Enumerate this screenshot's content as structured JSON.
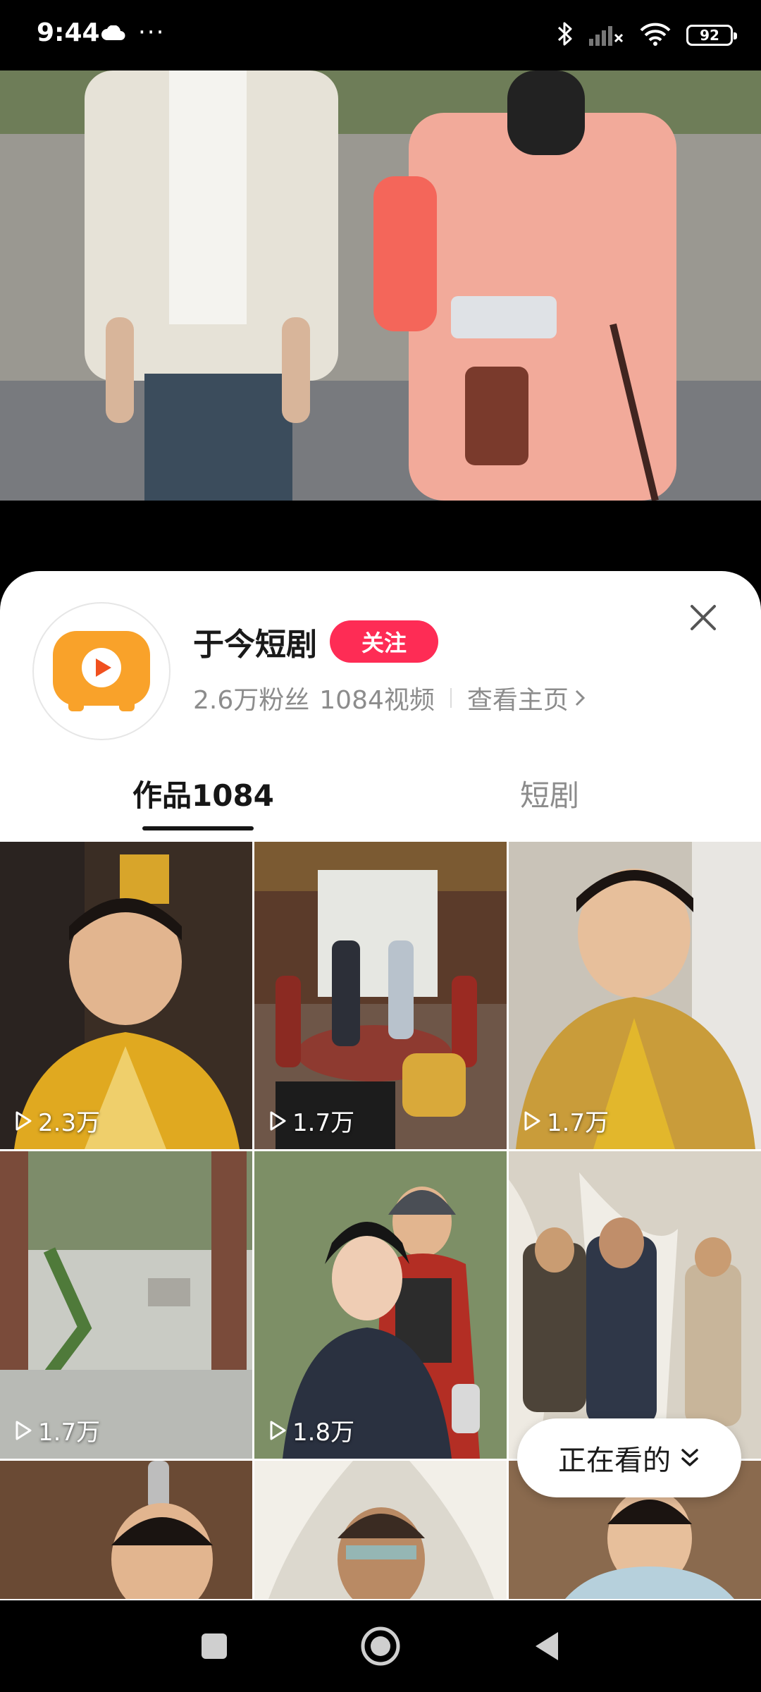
{
  "status_bar": {
    "time": "9:44",
    "battery": "92",
    "icons": [
      "cloud-icon",
      "more-dots-icon",
      "bluetooth-icon",
      "signal-icon",
      "wifi-icon",
      "battery-icon"
    ]
  },
  "profile": {
    "name": "于今短剧",
    "follow_label": "关注",
    "fans": "2.6万粉丝",
    "videos": "1084视频",
    "homepage_label": "查看主页",
    "close_icon": "close-icon"
  },
  "tabs": [
    {
      "label": "作品1084",
      "active": true
    },
    {
      "label": "短剧",
      "active": false
    }
  ],
  "grid": {
    "tiles": [
      {
        "views": "2.3万"
      },
      {
        "views": "1.7万"
      },
      {
        "views": "1.7万"
      },
      {
        "views": "1.7万"
      },
      {
        "views": "1.8万"
      },
      {
        "views": ""
      },
      {
        "views": ""
      },
      {
        "views": ""
      },
      {
        "views": ""
      }
    ]
  },
  "floating": {
    "watching_label": "正在看的"
  },
  "colors": {
    "accent": "#fe2c55",
    "logo_orange": "#f9a22a"
  }
}
